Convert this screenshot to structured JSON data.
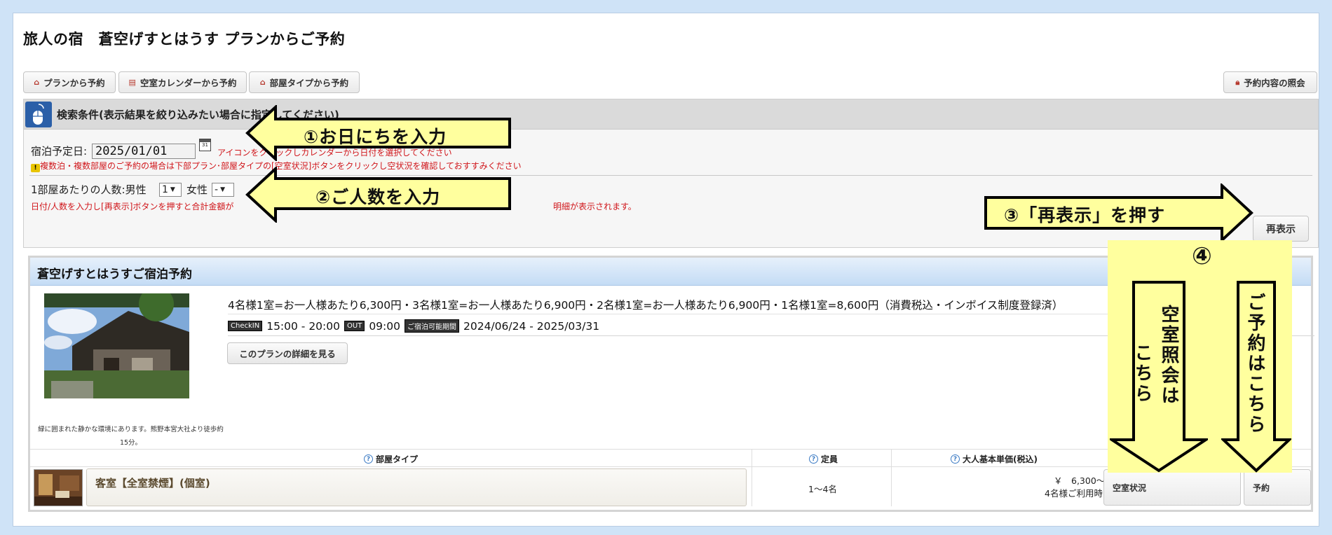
{
  "page": {
    "title": "旅人の宿　蒼空げすとはうす プランからご予約"
  },
  "nav": {
    "plan_btn": "プランから予約",
    "calendar_btn": "空室カレンダーから予約",
    "roomtype_btn": "部屋タイプから予約",
    "inquiry_btn": "予約内容の照会"
  },
  "search": {
    "header": "検索条件(表示結果を絞り込みたい場合に指定してください)",
    "date_label": "宿泊予定日:",
    "date_value": "2025/01/01",
    "date_hint": "アイコンをクリックしカレンダーから日付を選択してください",
    "warning": "複数泊・複数部屋のご予約の場合は下部プラン･部屋タイプの[空室状況]ボタンをクリックし空状況を確認しておすすみください",
    "people_label": "1部屋あたりの人数:男性",
    "male_value": "1",
    "female_label": "女性",
    "female_value": "-",
    "people_note": "日付/人数を入力し[再表示]ボタンを押すと合計金額が",
    "people_note_tail": "明細が表示されます。",
    "redisplay_btn": "再表示"
  },
  "annotations": {
    "step1": "①お日にちを入力",
    "step2": "②ご人数を入力",
    "step3": "③「再表示」を押す",
    "step4": "④",
    "vacancy_a": "空室照会は",
    "vacancy_b": "こちら",
    "reserve": "ご予約はこちら"
  },
  "plan": {
    "title": "蒼空げすとはうすご宿泊予約",
    "prices": "4名様1室=お一人様あたり6,300円・3名様1室=お一人様あたり6,900円・2名様1室=お一人様あたり6,900円・1名様1室=8,600円（消費税込・インボイス制度登録済）",
    "checkin_tag": "CheckIN",
    "checkin_time": "15:00 - 20:00",
    "checkout_tag": "OUT",
    "checkout_time": "09:00",
    "period_tag": "ご宿泊可能期間",
    "period": "2024/06/24 - 2025/03/31",
    "detail_btn": "このプランの詳細を見る",
    "photo_caption_1": "緑に囲まれた静かな環境にあります。熊野本宮大社より徒歩約",
    "photo_caption_2": "15分。"
  },
  "table": {
    "col_room": "部屋タイプ",
    "col_capacity": "定員",
    "col_price": "大人基本単価(税込)",
    "rows": [
      {
        "room": "客室【全室禁煙】(個室)",
        "capacity": "1～4名",
        "price": "￥　6,300～",
        "price_note": "4名様ご利用時",
        "vacancy_btn": "空室状況",
        "reserve_btn": "予約"
      }
    ]
  },
  "colors": {
    "accent_red": "#d0161b",
    "header_blue": "#c4dcf5",
    "annotation_yellow": "#ffff9e"
  }
}
